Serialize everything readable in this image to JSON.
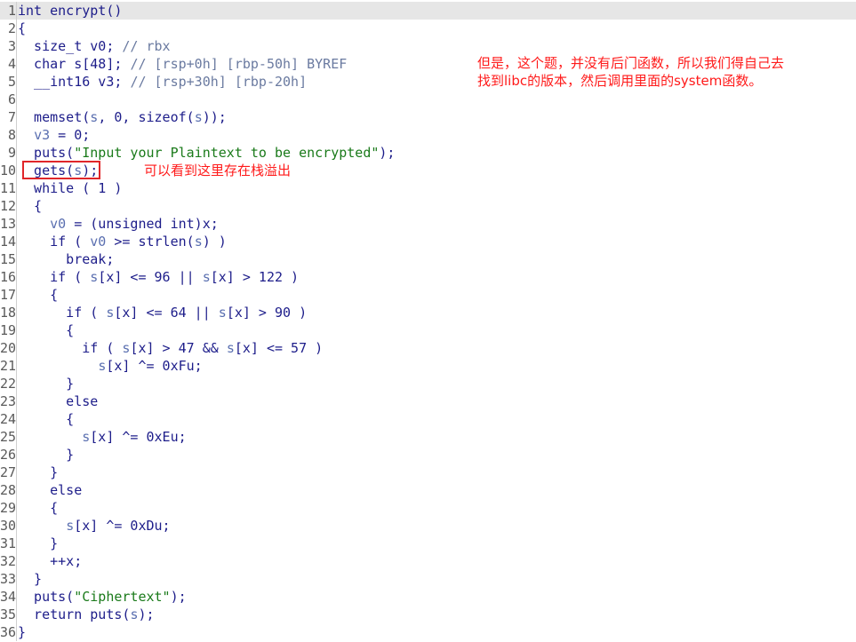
{
  "code": {
    "lines": [
      {
        "n": "1",
        "segs": [
          {
            "t": "int encrypt()",
            "c": "id"
          }
        ]
      },
      {
        "n": "2",
        "segs": [
          {
            "t": "{",
            "c": "id"
          }
        ]
      },
      {
        "n": "3",
        "segs": [
          {
            "t": "  size_t v0; ",
            "c": "id"
          },
          {
            "t": "// rbx",
            "c": "cmt"
          }
        ]
      },
      {
        "n": "4",
        "segs": [
          {
            "t": "  char s[48]; ",
            "c": "id"
          },
          {
            "t": "// [rsp+0h] [rbp-50h] BYREF",
            "c": "cmt"
          }
        ]
      },
      {
        "n": "5",
        "segs": [
          {
            "t": "  __int16 v3; ",
            "c": "id"
          },
          {
            "t": "// [rsp+30h] [rbp-20h]",
            "c": "cmt"
          }
        ]
      },
      {
        "n": "6",
        "segs": []
      },
      {
        "n": "7",
        "segs": [
          {
            "t": "  memset(",
            "c": "id"
          },
          {
            "t": "s",
            "c": "var"
          },
          {
            "t": ", 0, sizeof(",
            "c": "id"
          },
          {
            "t": "s",
            "c": "var"
          },
          {
            "t": "));",
            "c": "id"
          }
        ]
      },
      {
        "n": "8",
        "segs": [
          {
            "t": "  ",
            "c": "id"
          },
          {
            "t": "v3",
            "c": "var"
          },
          {
            "t": " = 0;",
            "c": "id"
          }
        ]
      },
      {
        "n": "9",
        "segs": [
          {
            "t": "  puts(",
            "c": "id"
          },
          {
            "t": "\"Input your Plaintext to be encrypted\"",
            "c": "str"
          },
          {
            "t": ");",
            "c": "id"
          }
        ]
      },
      {
        "n": "10",
        "segs": [
          {
            "t": "  gets(",
            "c": "id"
          },
          {
            "t": "s",
            "c": "var"
          },
          {
            "t": ");",
            "c": "id"
          }
        ]
      },
      {
        "n": "11",
        "segs": [
          {
            "t": "  while ( 1 )",
            "c": "id"
          }
        ]
      },
      {
        "n": "12",
        "segs": [
          {
            "t": "  {",
            "c": "id"
          }
        ]
      },
      {
        "n": "13",
        "segs": [
          {
            "t": "    ",
            "c": "id"
          },
          {
            "t": "v0",
            "c": "var"
          },
          {
            "t": " = (unsigned int)x;",
            "c": "id"
          }
        ]
      },
      {
        "n": "14",
        "segs": [
          {
            "t": "    if ( ",
            "c": "id"
          },
          {
            "t": "v0",
            "c": "var"
          },
          {
            "t": " >= strlen(",
            "c": "id"
          },
          {
            "t": "s",
            "c": "var"
          },
          {
            "t": ") )",
            "c": "id"
          }
        ]
      },
      {
        "n": "15",
        "segs": [
          {
            "t": "      break;",
            "c": "id"
          }
        ]
      },
      {
        "n": "16",
        "segs": [
          {
            "t": "    if ( ",
            "c": "id"
          },
          {
            "t": "s",
            "c": "var"
          },
          {
            "t": "[x] <= 96 || ",
            "c": "id"
          },
          {
            "t": "s",
            "c": "var"
          },
          {
            "t": "[x] > 122 )",
            "c": "id"
          }
        ]
      },
      {
        "n": "17",
        "segs": [
          {
            "t": "    {",
            "c": "id"
          }
        ]
      },
      {
        "n": "18",
        "segs": [
          {
            "t": "      if ( ",
            "c": "id"
          },
          {
            "t": "s",
            "c": "var"
          },
          {
            "t": "[x] <= 64 || ",
            "c": "id"
          },
          {
            "t": "s",
            "c": "var"
          },
          {
            "t": "[x] > 90 )",
            "c": "id"
          }
        ]
      },
      {
        "n": "19",
        "segs": [
          {
            "t": "      {",
            "c": "id"
          }
        ]
      },
      {
        "n": "20",
        "segs": [
          {
            "t": "        if ( ",
            "c": "id"
          },
          {
            "t": "s",
            "c": "var"
          },
          {
            "t": "[x] > 47 && ",
            "c": "id"
          },
          {
            "t": "s",
            "c": "var"
          },
          {
            "t": "[x] <= 57 )",
            "c": "id"
          }
        ]
      },
      {
        "n": "21",
        "segs": [
          {
            "t": "          ",
            "c": "id"
          },
          {
            "t": "s",
            "c": "var"
          },
          {
            "t": "[x] ^= 0xFu;",
            "c": "id"
          }
        ]
      },
      {
        "n": "22",
        "segs": [
          {
            "t": "      }",
            "c": "id"
          }
        ]
      },
      {
        "n": "23",
        "segs": [
          {
            "t": "      else",
            "c": "id"
          }
        ]
      },
      {
        "n": "24",
        "segs": [
          {
            "t": "      {",
            "c": "id"
          }
        ]
      },
      {
        "n": "25",
        "segs": [
          {
            "t": "        ",
            "c": "id"
          },
          {
            "t": "s",
            "c": "var"
          },
          {
            "t": "[x] ^= 0xEu;",
            "c": "id"
          }
        ]
      },
      {
        "n": "26",
        "segs": [
          {
            "t": "      }",
            "c": "id"
          }
        ]
      },
      {
        "n": "27",
        "segs": [
          {
            "t": "    }",
            "c": "id"
          }
        ]
      },
      {
        "n": "28",
        "segs": [
          {
            "t": "    else",
            "c": "id"
          }
        ]
      },
      {
        "n": "29",
        "segs": [
          {
            "t": "    {",
            "c": "id"
          }
        ]
      },
      {
        "n": "30",
        "segs": [
          {
            "t": "      ",
            "c": "id"
          },
          {
            "t": "s",
            "c": "var"
          },
          {
            "t": "[x] ^= 0xDu;",
            "c": "id"
          }
        ]
      },
      {
        "n": "31",
        "segs": [
          {
            "t": "    }",
            "c": "id"
          }
        ]
      },
      {
        "n": "32",
        "segs": [
          {
            "t": "    ++x;",
            "c": "id"
          }
        ]
      },
      {
        "n": "33",
        "segs": [
          {
            "t": "  }",
            "c": "id"
          }
        ]
      },
      {
        "n": "34",
        "segs": [
          {
            "t": "  puts(",
            "c": "id"
          },
          {
            "t": "\"Ciphertext\"",
            "c": "str"
          },
          {
            "t": ");",
            "c": "id"
          }
        ]
      },
      {
        "n": "35",
        "segs": [
          {
            "t": "  return puts(",
            "c": "id"
          },
          {
            "t": "s",
            "c": "var"
          },
          {
            "t": ");",
            "c": "id"
          }
        ]
      },
      {
        "n": "36",
        "segs": [
          {
            "t": "}",
            "c": "id"
          }
        ]
      }
    ]
  },
  "annotations": {
    "overflow_note": "可以看到这里存在栈溢出",
    "libc_note_line1": "但是，这个题，并没有后门函数，所以我们得自己去",
    "libc_note_line2": "找到libc的版本，然后调用里面的system函数。"
  },
  "colors": {
    "highlight_line": "#e6e6e6",
    "annotation_red": "#ff1a1a",
    "box_red": "#e0262a"
  }
}
